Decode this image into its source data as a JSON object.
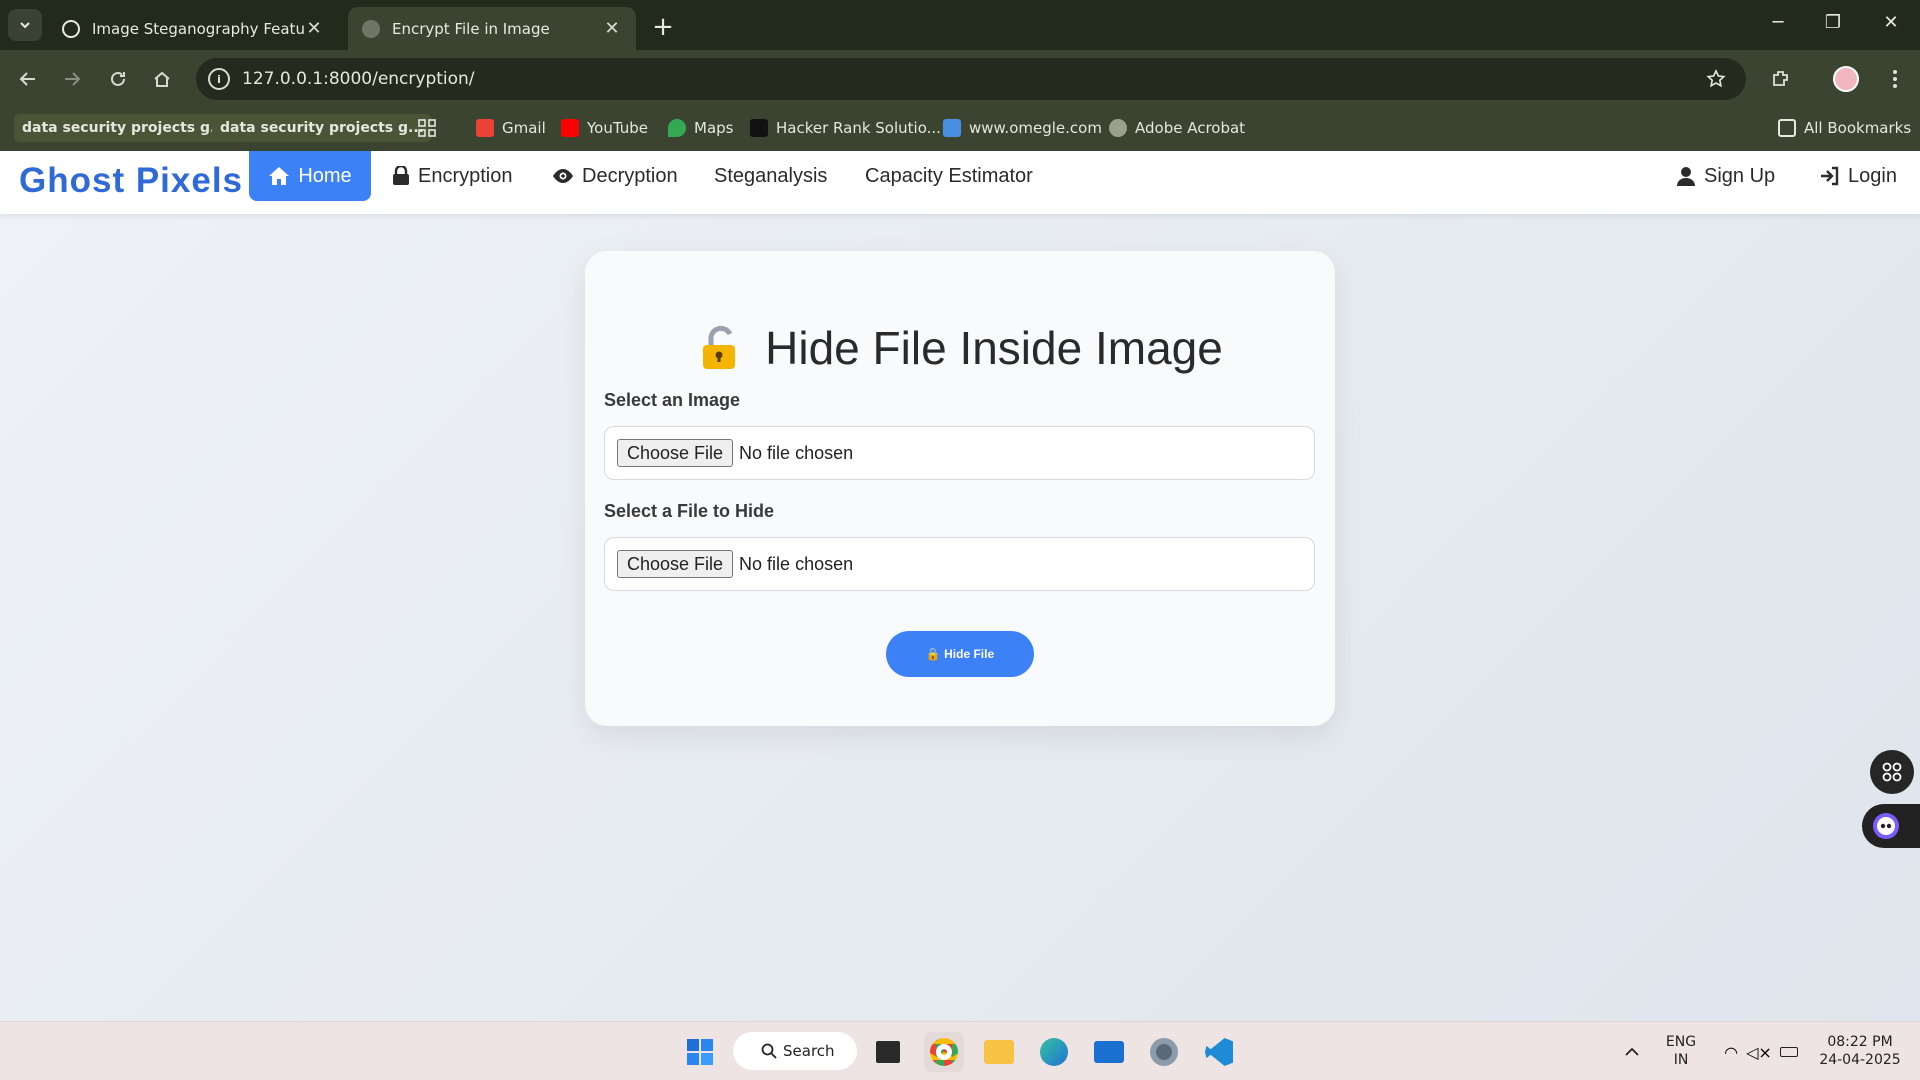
{
  "browser": {
    "tabs": [
      {
        "title": "Image Steganography Feature I",
        "active": false
      },
      {
        "title": "Encrypt File in Image",
        "active": true
      }
    ],
    "url": "127.0.0.1:8000/encryption/",
    "bookmarks": [
      {
        "label": "data security projects g..."
      },
      {
        "label": "data security projects g..."
      },
      {
        "label": "Gmail"
      },
      {
        "label": "YouTube"
      },
      {
        "label": "Maps"
      },
      {
        "label": "Hacker Rank Solutio..."
      },
      {
        "label": "www.omegle.com"
      },
      {
        "label": "Adobe Acrobat"
      }
    ],
    "all_bookmarks": "All Bookmarks"
  },
  "site": {
    "brand": "Ghost Pixels",
    "nav": {
      "home": "Home",
      "encryption": "Encryption",
      "decryption": "Decryption",
      "steganalysis": "Steganalysis",
      "capacity": "Capacity Estimator",
      "signup": "Sign Up",
      "login": "Login"
    },
    "accent": "#3c82f6"
  },
  "form": {
    "title": "Hide File Inside Image",
    "image_label": "Select an Image",
    "file_label": "Select a File to Hide",
    "choose_file": "Choose File",
    "no_file": "No file chosen",
    "submit": "🔒 Hide File"
  },
  "taskbar": {
    "search": "Search",
    "lang1": "ENG",
    "lang2": "IN",
    "time": "08:22 PM",
    "date": "24-04-2025"
  }
}
